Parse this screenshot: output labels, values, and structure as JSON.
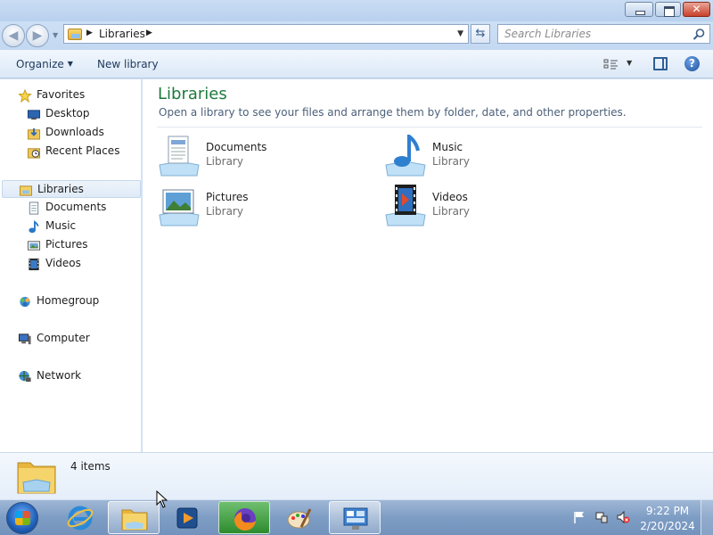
{
  "window": {
    "title_buttons": {
      "minimize": "minimize-icon",
      "maximize": "maximize-icon",
      "close": "close-icon"
    }
  },
  "address": {
    "crumb": "Libraries",
    "search_placeholder": "Search Libraries"
  },
  "toolbar": {
    "organize_label": "Organize",
    "new_library_label": "New library",
    "help_label": "?"
  },
  "nav": {
    "favorites": {
      "label": "Favorites",
      "items": [
        {
          "label": "Desktop",
          "icon": "desktop-icon"
        },
        {
          "label": "Downloads",
          "icon": "downloads-icon"
        },
        {
          "label": "Recent Places",
          "icon": "recent-places-icon"
        }
      ]
    },
    "libraries": {
      "label": "Libraries",
      "items": [
        {
          "label": "Documents",
          "icon": "documents-icon"
        },
        {
          "label": "Music",
          "icon": "music-icon"
        },
        {
          "label": "Pictures",
          "icon": "pictures-icon"
        },
        {
          "label": "Videos",
          "icon": "videos-icon"
        }
      ]
    },
    "homegroup": "Homegroup",
    "computer": "Computer",
    "network": "Network"
  },
  "content": {
    "title": "Libraries",
    "subtitle": "Open a library to see your files and arrange them by folder, date, and other properties.",
    "tiles": [
      {
        "name": "Documents",
        "type": "Library",
        "icon": "documents-library-icon"
      },
      {
        "name": "Music",
        "type": "Library",
        "icon": "music-library-icon"
      },
      {
        "name": "Pictures",
        "type": "Library",
        "icon": "pictures-library-icon"
      },
      {
        "name": "Videos",
        "type": "Library",
        "icon": "videos-library-icon"
      }
    ]
  },
  "details": {
    "item_count": "4 items"
  },
  "taskbar": {
    "apps": [
      "internet-explorer-icon",
      "windows-explorer-icon",
      "media-player-icon",
      "firefox-icon",
      "paint-icon",
      "control-panel-icon"
    ],
    "active_app": "windows-explorer-icon",
    "time": "9:22 PM",
    "date": "2/20/2024"
  },
  "colors": {
    "title_green": "#1e7a3c",
    "toolbar_text": "#1e395b",
    "taskbar": "#7e9dc4"
  }
}
